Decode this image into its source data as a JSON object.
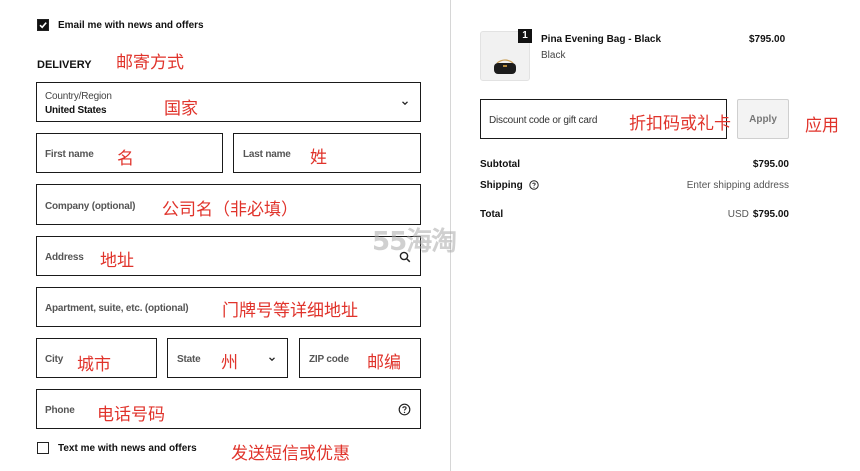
{
  "left": {
    "email_optin": {
      "label": "Email me with news and offers",
      "checked": true
    },
    "delivery": {
      "heading": "DELIVERY",
      "annotation": "邮寄方式"
    },
    "country": {
      "label": "Country/Region",
      "value": "United States",
      "annotation": "国家"
    },
    "first_name": {
      "placeholder": "First name",
      "annotation": "名"
    },
    "last_name": {
      "placeholder": "Last name",
      "annotation": "姓"
    },
    "company": {
      "placeholder": "Company (optional)",
      "annotation": "公司名（非必填）"
    },
    "address": {
      "placeholder": "Address",
      "annotation": "地址"
    },
    "apartment": {
      "placeholder": "Apartment, suite, etc. (optional)",
      "annotation": "门牌号等详细地址"
    },
    "city": {
      "placeholder": "City",
      "annotation": "城市"
    },
    "state": {
      "placeholder": "State",
      "annotation": "州"
    },
    "zip": {
      "placeholder": "ZIP code",
      "annotation": "邮编"
    },
    "phone": {
      "placeholder": "Phone",
      "annotation": "电话号码"
    },
    "sms_optin": {
      "label": "Text me with news and offers",
      "checked": false,
      "annotation": "发送短信或优惠"
    }
  },
  "right": {
    "item": {
      "quantity": "1",
      "name": "Pina Evening Bag - Black",
      "variant": "Black",
      "price": "$795.00"
    },
    "discount": {
      "placeholder": "Discount code or gift card",
      "annotation": "折扣码或礼卡",
      "apply_label": "Apply",
      "apply_annotation": "应用"
    },
    "summary": {
      "subtotal_label": "Subtotal",
      "subtotal_value": "$795.00",
      "shipping_label": "Shipping",
      "shipping_value": "Enter shipping address",
      "total_label": "Total",
      "total_currency": "USD",
      "total_value": "$795.00"
    }
  },
  "watermark": "55海淘",
  "colors": {
    "annotation": "#e0332b",
    "border": "#1a1a1a",
    "apply_button_bg": "#f3f3f3"
  }
}
